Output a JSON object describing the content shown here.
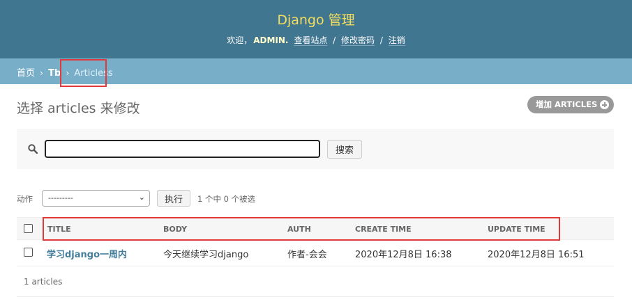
{
  "header": {
    "title": "Django 管理",
    "welcome": "欢迎，",
    "username": "ADMIN.",
    "links": [
      "查看站点",
      "修改密码",
      "注销"
    ],
    "separator": "/"
  },
  "breadcrumbs": {
    "home": "首页",
    "app": "Tb",
    "current": "Articless",
    "arrow": "›"
  },
  "page_title": "选择 articles 来修改",
  "add_button": "增加 ARTICLES",
  "search": {
    "value": "",
    "button": "搜索"
  },
  "actions": {
    "label": "动作",
    "selected": "---------",
    "go_button": "执行",
    "selection_count": "1 个中 0 个被选"
  },
  "table": {
    "columns": [
      "TITLE",
      "BODY",
      "AUTH",
      "CREATE TIME",
      "UPDATE TIME"
    ],
    "rows": [
      [
        "学习django一周内",
        "今天继续学习django",
        "作者-会会",
        "2020年12月8日 16:38",
        "2020年12月8日 16:51"
      ]
    ]
  },
  "result_count": "1 articles",
  "colors": {
    "header_bg": "#417690",
    "brand": "#f5dd5d",
    "breadcrumb_bg": "#79aec8",
    "link": "#447e9b",
    "highlight": "#e23a3a"
  }
}
